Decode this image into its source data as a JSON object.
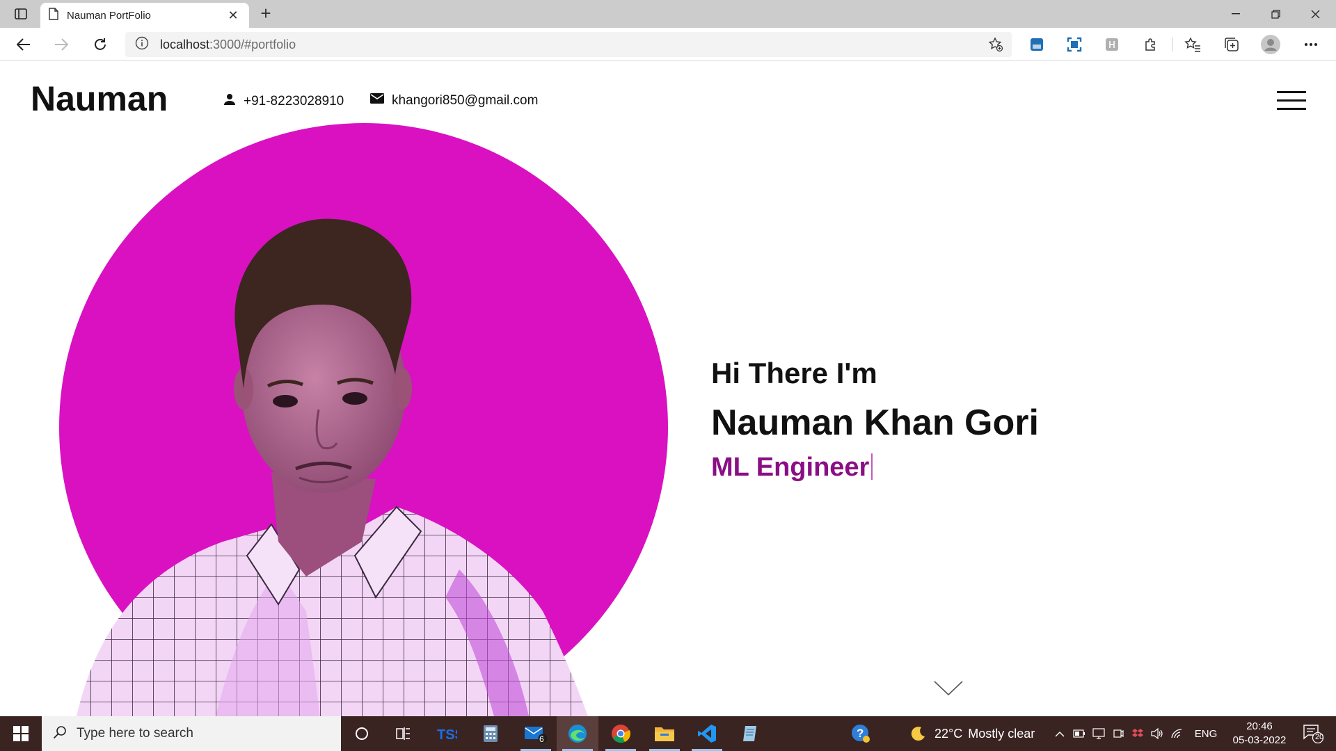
{
  "browser": {
    "tab_title": "Nauman PortFolio",
    "url_host": "localhost",
    "url_path": ":3000/#portfolio"
  },
  "site": {
    "brand": "Nauman",
    "phone": "+91-8223028910",
    "email": "khangori850@gmail.com",
    "accent_color": "#d911c1",
    "role_color": "#8a0f84"
  },
  "hero": {
    "greeting": "Hi There I'm",
    "name": "Nauman Khan Gori",
    "role": "ML Engineer"
  },
  "taskbar": {
    "search_placeholder": "Type here to search",
    "mail_badge": "6",
    "weather_temp": "22°C",
    "weather_text": "Mostly clear",
    "language": "ENG",
    "time": "20:46",
    "date": "05-03-2022",
    "notification_count": "20"
  }
}
